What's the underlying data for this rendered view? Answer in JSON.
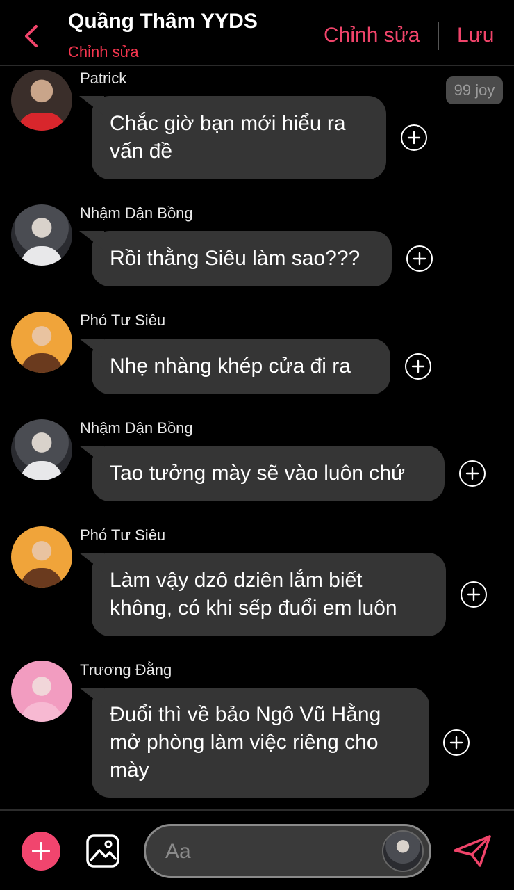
{
  "header": {
    "title": "Quầng Thâm YYDS",
    "subtitle": "Chỉnh sửa",
    "edit_label": "Chỉnh sửa",
    "save_label": "Lưu"
  },
  "badge": "99 joy",
  "messages": [
    {
      "sender": "Patrick",
      "lines": [
        "Chắc giờ bạn mới hiểu ra",
        "vấn đề"
      ]
    },
    {
      "sender": "Nhậm Dận Bồng",
      "lines": [
        "Rồi thằng Siêu làm sao???"
      ]
    },
    {
      "sender": "Phó Tư Siêu",
      "lines": [
        "Nhẹ nhàng khép cửa đi ra"
      ]
    },
    {
      "sender": "Nhậm Dận Bồng",
      "lines": [
        "Tao tưởng mày sẽ vào luôn chứ"
      ]
    },
    {
      "sender": "Phó Tư Siêu",
      "lines": [
        "Làm vậy dzô dziên lắm biết",
        "không, có khi sếp đuổi em luôn"
      ]
    },
    {
      "sender": "Trương Đằng",
      "lines": [
        "Đuổi thì về bảo Ngô Vũ Hằng",
        "mở phòng làm việc riêng cho",
        "mày"
      ]
    }
  ],
  "composer": {
    "placeholder": "Aa"
  },
  "colors": {
    "accent": "#f0446a",
    "subtitle": "#f5364f",
    "bubble": "#353535",
    "background": "#000000"
  },
  "icons": {
    "back": "chevron-left-icon",
    "add": "plus-icon",
    "image": "image-icon",
    "send": "send-icon"
  }
}
